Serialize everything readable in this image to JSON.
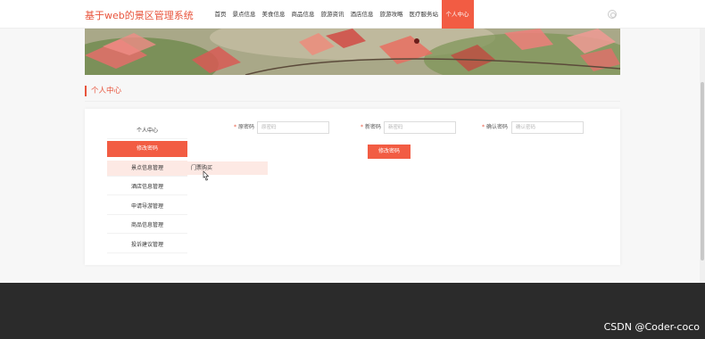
{
  "header": {
    "site_title": "基于web的景区管理系统",
    "nav": [
      {
        "label": "首页"
      },
      {
        "label": "景点信息"
      },
      {
        "label": "美食信息"
      },
      {
        "label": "商品信息"
      },
      {
        "label": "旅游资讯"
      },
      {
        "label": "酒店信息"
      },
      {
        "label": "旅游攻略"
      },
      {
        "label": "医疗服务站"
      },
      {
        "label": "个人中心"
      }
    ],
    "active_nav": "个人中心"
  },
  "section": {
    "title": "个人中心"
  },
  "sidebar": {
    "items": [
      {
        "label": "个人中心"
      },
      {
        "label": "修改密码"
      },
      {
        "label": "景点信息管理"
      },
      {
        "label": "酒店信息管理"
      },
      {
        "label": "申请导游管理"
      },
      {
        "label": "商品信息管理"
      },
      {
        "label": "投诉建议管理"
      }
    ],
    "active": "修改密码",
    "hovered": "景点信息管理",
    "submenu": {
      "label": "门票购买"
    }
  },
  "form": {
    "old_password": {
      "label": "原密码",
      "placeholder": "原密码"
    },
    "new_password": {
      "label": "新密码",
      "placeholder": "新密码"
    },
    "confirm_password": {
      "label": "确认密码",
      "placeholder": "确认密码"
    },
    "submit_label": "修改密码"
  },
  "colors": {
    "accent": "#f25c43",
    "footer": "#2b2b2b"
  },
  "watermark": "CSDN @Coder-coco"
}
